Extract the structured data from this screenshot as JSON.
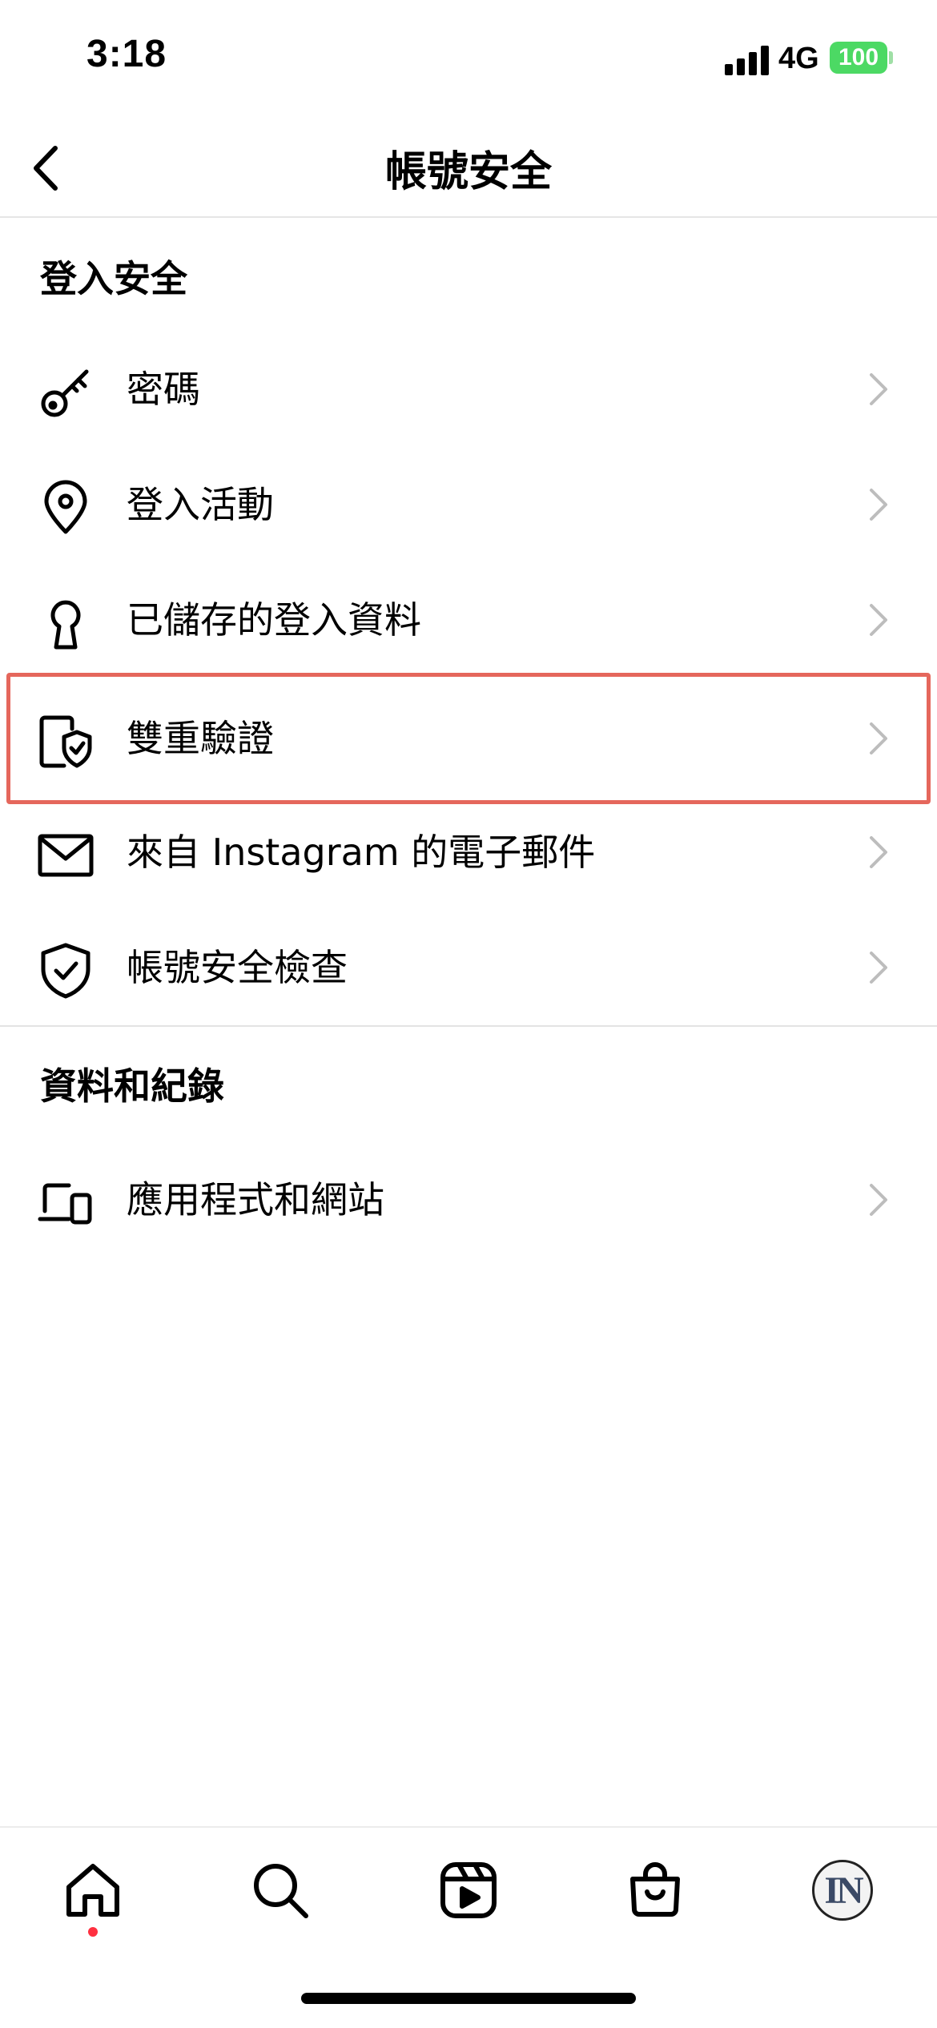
{
  "status_bar": {
    "time": "3:18",
    "network": "4G",
    "battery": "100"
  },
  "header": {
    "title": "帳號安全",
    "back_icon": "chevron-left-icon"
  },
  "sections": {
    "login_security": {
      "title": "登入安全",
      "items": [
        {
          "label": "密碼",
          "icon": "key-icon"
        },
        {
          "label": "登入活動",
          "icon": "location-pin-icon"
        },
        {
          "label": "已儲存的登入資料",
          "icon": "keyhole-icon"
        },
        {
          "label": "雙重驗證",
          "icon": "phone-shield-icon"
        },
        {
          "label": "來自 Instagram 的電子郵件",
          "icon": "envelope-icon"
        },
        {
          "label": "帳號安全檢查",
          "icon": "shield-check-icon"
        }
      ]
    },
    "data_history": {
      "title": "資料和紀錄",
      "items": [
        {
          "label": "應用程式和網站",
          "icon": "laptop-phone-icon"
        }
      ]
    }
  },
  "highlight_color": "#e5675c",
  "tabbar": {
    "tabs": [
      "home-icon",
      "search-icon",
      "reels-icon",
      "shop-icon",
      "profile-avatar"
    ],
    "avatar_text": "IN",
    "notification_color": "#ff3040"
  }
}
